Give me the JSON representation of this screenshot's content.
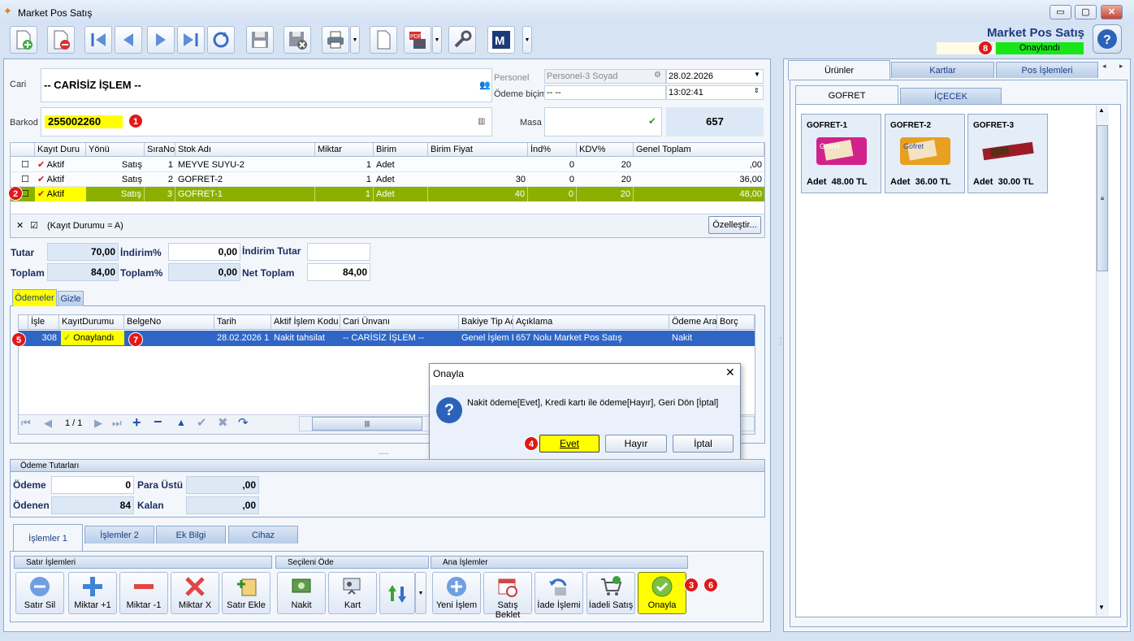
{
  "window": {
    "title": "Market Pos Satış",
    "minimize": "▭",
    "maximize": "▢",
    "close": "✕"
  },
  "header": {
    "title": "Market Pos Satış",
    "doc_no": "657",
    "status": "Onaylandı",
    "status_color": "#19e619",
    "help": "?"
  },
  "toolbar": {
    "icons": [
      "new-doc-icon",
      "delete-doc-icon",
      "first-icon",
      "prev-icon",
      "next-icon",
      "last-icon",
      "refresh-icon",
      "save-icon",
      "cancel-save-icon",
      "print-icon",
      "blank-doc-icon",
      "pdf-icon",
      "settings-icon",
      "m-icon"
    ]
  },
  "form": {
    "cari_label": "Cari",
    "cari_value": "-- CARİSİZ İŞLEM --",
    "barkod_label": "Barkod",
    "barkod_value": "255002260",
    "personel_label": "Personel",
    "personel_value": "Personel-3 Soyad",
    "odeme_label": "Ödeme biçimi",
    "odeme_value": "-- --",
    "date": "28.02.2026",
    "time": "13:02:41",
    "masa_label": "Masa",
    "masa_no": "657"
  },
  "grid": {
    "columns": [
      "Kayıt Duru",
      "Yönü",
      "SıraNo",
      "Stok Adı",
      "Miktar",
      "Birim",
      "Birim Fiyat",
      "İnd%",
      "KDV%",
      "Genel Toplam"
    ],
    "rows": [
      {
        "status": "Aktif",
        "yon": "Satış",
        "sira": "1",
        "stok": "MEYVE SUYU-2",
        "miktar": "1",
        "birim": "Adet",
        "fiyat": "",
        "ind": "0",
        "kdv": "20",
        "toplam": ",00"
      },
      {
        "status": "Aktif",
        "yon": "Satış",
        "sira": "2",
        "stok": "GOFRET-2",
        "miktar": "1",
        "birim": "Adet",
        "fiyat": "30",
        "ind": "0",
        "kdv": "20",
        "toplam": "36,00"
      },
      {
        "status": "Aktif",
        "yon": "Satış",
        "sira": "3",
        "stok": "GOFRET-1",
        "miktar": "1",
        "birim": "Adet",
        "fiyat": "40",
        "ind": "0",
        "kdv": "20",
        "toplam": "48,00"
      }
    ],
    "filter_text": "(Kayıt Durumu = A)",
    "customize": "Özelleştir..."
  },
  "totals": {
    "tutar_label": "Tutar",
    "tutar": "70,00",
    "indirim_pct_label": "İndirim%",
    "indirim_pct": "0,00",
    "indirim_tutar_label": "İndirim Tutar",
    "indirim_tutar": "",
    "toplam_label": "Toplam",
    "toplam": "84,00",
    "toplam_pct_label": "Toplam%",
    "toplam_pct": "0,00",
    "net_label": "Net Toplam",
    "net": "84,00"
  },
  "payments": {
    "tabs": [
      "Ödemeler",
      "Gizle"
    ],
    "columns": [
      "İşle",
      "KayıtDurumu",
      "BelgeNo",
      "Tarih",
      "Aktif İşlem Kodu",
      "Cari Ünvanı",
      "Bakiye Tip Ac",
      "Açıklama",
      "Ödeme Ara",
      "Borç"
    ],
    "row": {
      "isle": "308",
      "durum": "Onaylandı",
      "belge": "",
      "tarih": "28.02.2026 1",
      "kod": "Nakit tahsilat",
      "cari": "-- CARİSİZ İŞLEM --",
      "bakiye": "Genel İşlem E",
      "aciklama": "657 Nolu Market Pos Satış",
      "odeme": "Nakit",
      "borc": ""
    },
    "pager": "1 / 1"
  },
  "odeme_tutarlari": {
    "title": "Ödeme Tutarları",
    "odeme_label": "Ödeme",
    "odeme": "0",
    "para_ustu_label": "Para Üstü",
    "para_ustu": ",00",
    "odenen_label": "Ödenen",
    "odenen": "84",
    "kalan_label": "Kalan",
    "kalan": ",00"
  },
  "bottom_tabs": [
    "İşlemler 1",
    "İşlemler 2",
    "Ek Bilgi",
    "Cihaz"
  ],
  "groups": {
    "satir": "Satır İşlemleri",
    "secileni": "Seçileni Öde",
    "ana": "Ana İşlemler"
  },
  "buttons": {
    "satir_sil": "Satır Sil",
    "miktar_plus": "Miktar +1",
    "miktar_minus": "Miktar -1",
    "miktar_x": "Miktar X",
    "satir_ekle": "Satır Ekle",
    "nakit": "Nakit",
    "kart": "Kart",
    "yeni_islem": "Yeni İşlem",
    "satis_beklet": "Satış Beklet",
    "iade_islemi": "İade İşlemi",
    "iadeli_satis": "İadeli Satış",
    "onayla": "Onayla"
  },
  "dialog": {
    "title": "Onayla",
    "message": "Nakit ödeme[Evet], Kredi kartı ile ödeme[Hayır], Geri Dön [İptal]",
    "yes": "Evet",
    "no": "Hayır",
    "cancel": "İptal"
  },
  "right_panel": {
    "tabs": [
      "Ürünler",
      "Kartlar",
      "Pos İşlemleri"
    ],
    "categories": [
      "GOFRET",
      "İÇECEK"
    ],
    "products": [
      {
        "name": "GOFRET-1",
        "unit": "Adet",
        "price": "48.00 TL"
      },
      {
        "name": "GOFRET-2",
        "unit": "Adet",
        "price": "36.00 TL"
      },
      {
        "name": "GOFRET-3",
        "unit": "Adet",
        "price": "30.00 TL"
      }
    ]
  },
  "annotations": [
    "1",
    "2",
    "3",
    "4",
    "5",
    "6",
    "7",
    "8"
  ],
  "colors": {
    "highlight": "#ffff00",
    "selected_row": "#8db000",
    "selected_payment": "#2f66c6",
    "badge": "#e01818"
  }
}
